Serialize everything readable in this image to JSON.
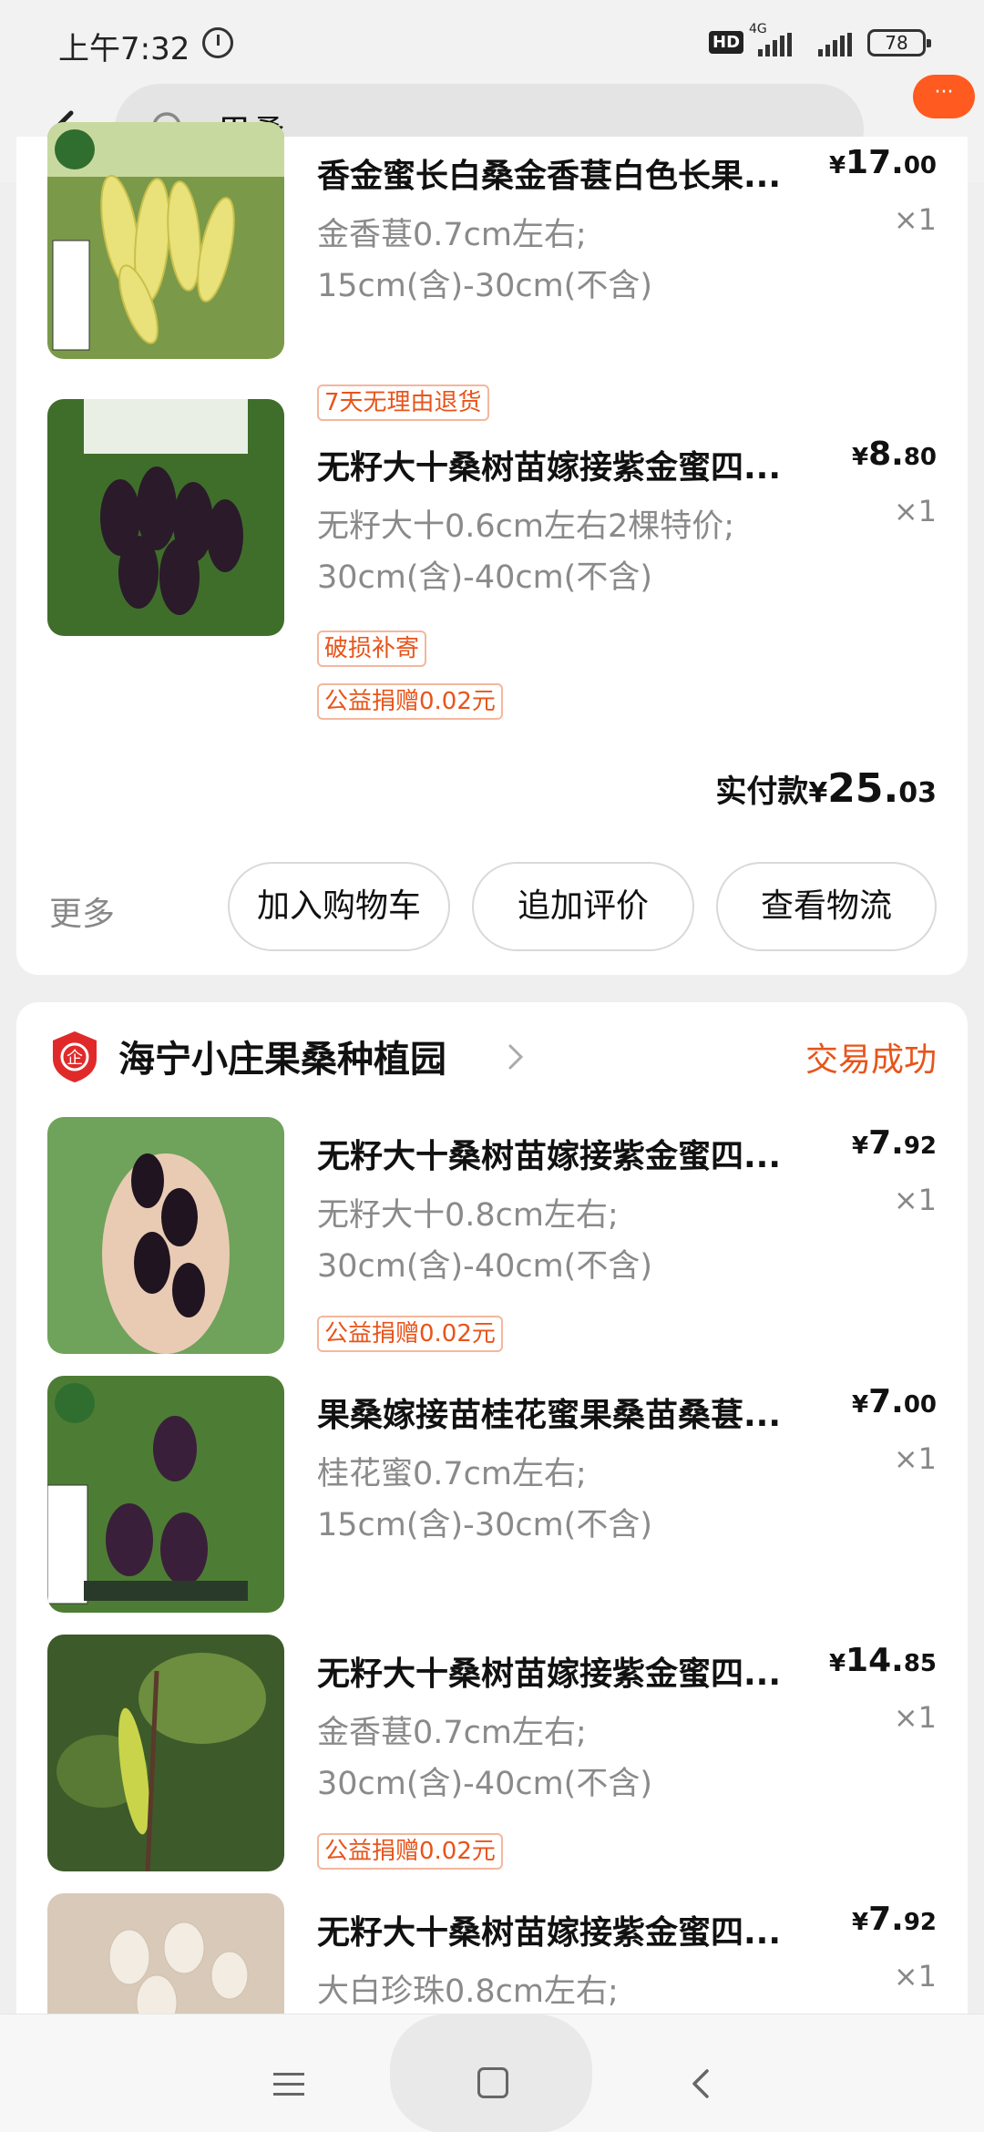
{
  "status_bar": {
    "time": "上午7:32",
    "hd": "HD",
    "network": "4G",
    "battery": "78"
  },
  "search": {
    "query": "果桑"
  },
  "header": {
    "message_badge": "···"
  },
  "order1": {
    "items": [
      {
        "title": "香金蜜长白桑金香葚白色长果...",
        "spec_line1": "金香葚0.7cm左右;",
        "spec_line2": "15cm(含)-30cm(不含)",
        "price_currency": "¥",
        "price_int": "17.",
        "price_dec": "00",
        "qty": "×1",
        "tags": [
          "7天无理由退货"
        ]
      },
      {
        "title": "无籽大十桑树苗嫁接紫金蜜四...",
        "spec_line1": "无籽大十0.6cm左右2棵特价;",
        "spec_line2": "30cm(含)-40cm(不含)",
        "price_currency": "¥",
        "price_int": "8.",
        "price_dec": "80",
        "qty": "×1",
        "tags": [
          "破损补寄",
          "公益捐赠0.02元"
        ]
      }
    ],
    "total_label": "实付款",
    "total_currency": "¥",
    "total_int": "25.",
    "total_dec": "03",
    "more_label": "更多",
    "buttons": {
      "add_cart": "加入购物车",
      "add_review": "追加评价",
      "view_logistics": "查看物流"
    }
  },
  "order2": {
    "shop_name": "海宁小庄果桑种植园",
    "status": "交易成功",
    "items": [
      {
        "title": "无籽大十桑树苗嫁接紫金蜜四...",
        "spec_line1": "无籽大十0.8cm左右;",
        "spec_line2": "30cm(含)-40cm(不含)",
        "price_currency": "¥",
        "price_int": "7.",
        "price_dec": "92",
        "qty": "×1",
        "tags": [
          "公益捐赠0.02元"
        ]
      },
      {
        "title": "果桑嫁接苗桂花蜜果桑苗桑葚...",
        "spec_line1": "桂花蜜0.7cm左右;",
        "spec_line2": "15cm(含)-30cm(不含)",
        "price_currency": "¥",
        "price_int": "7.",
        "price_dec": "00",
        "qty": "×1",
        "tags": []
      },
      {
        "title": "无籽大十桑树苗嫁接紫金蜜四...",
        "spec_line1": "金香葚0.7cm左右;",
        "spec_line2": "30cm(含)-40cm(不含)",
        "price_currency": "¥",
        "price_int": "14.",
        "price_dec": "85",
        "qty": "×1",
        "tags": [
          "公益捐赠0.02元"
        ]
      },
      {
        "title": "无籽大十桑树苗嫁接紫金蜜四...",
        "spec_line1": "大白珍珠0.8cm左右;",
        "spec_line2": "",
        "price_currency": "¥",
        "price_int": "7.",
        "price_dec": "92",
        "qty": "×1",
        "tags": []
      }
    ]
  },
  "colors": {
    "accent": "#e8541a",
    "badge": "#ff5a1f",
    "background": "#efefef"
  }
}
